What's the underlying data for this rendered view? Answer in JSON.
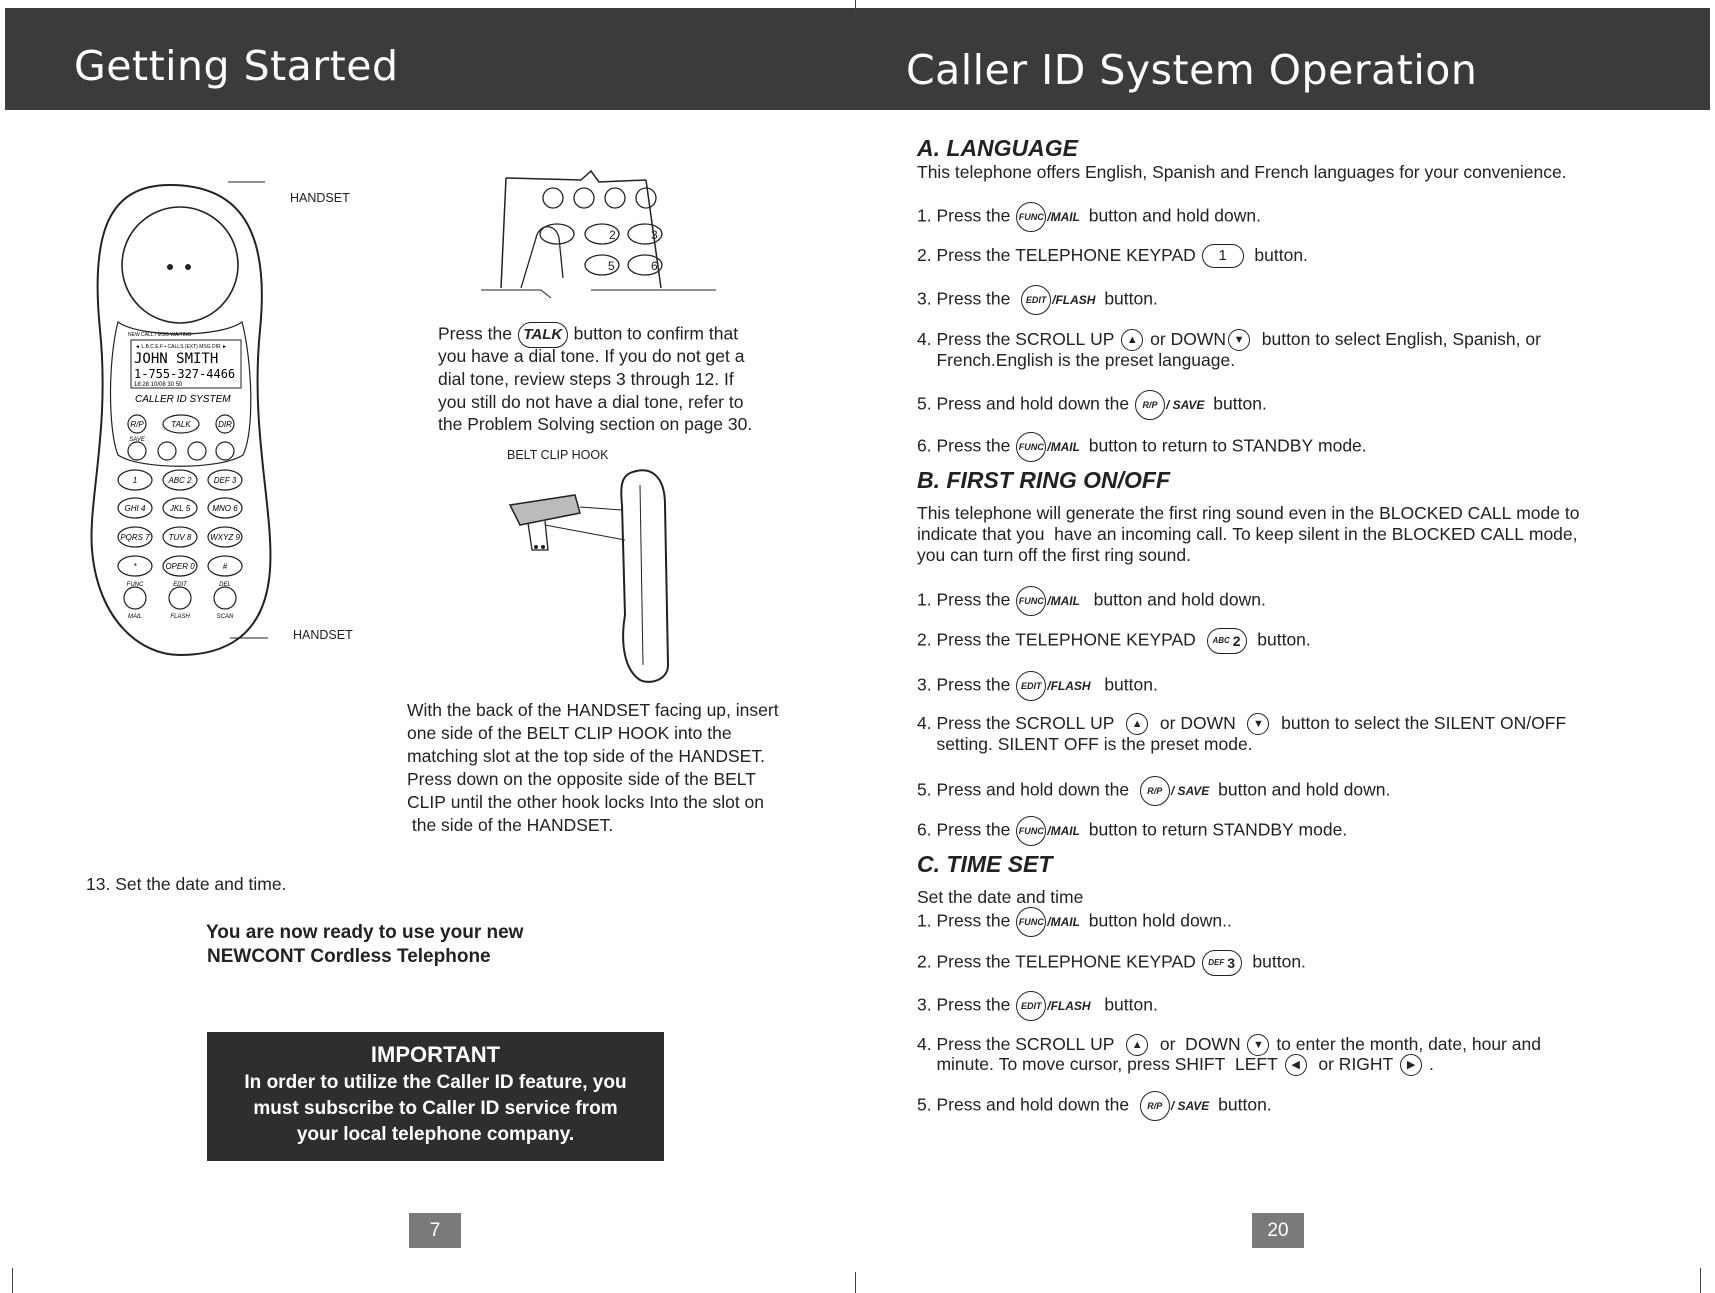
{
  "left_page": {
    "title": "Getting Started",
    "handset_label_top": "HANDSET",
    "handset_label_bottom": "HANDSET",
    "handset_display": {
      "status": "NEW CALL / MSG WAITING",
      "top_row": "◄ L.B.C.E.F ▪ CALLS (EXT) MSG DIR ►",
      "name": "JOHN  SMITH",
      "number": "1-755-327-4466",
      "bottom_row": "18:28 10/08  30  50",
      "brand": "CALLER  ID  SYSTEM",
      "keys": [
        "R/P",
        "TALK",
        "DIR",
        "SAVE",
        "1",
        "ABC 2",
        "DEF 3",
        "GHI 4",
        "JKL 5",
        "MNO 6",
        "PQRS 7",
        "TUV 8",
        "WXYZ 9",
        "*",
        "OPER 0",
        "#",
        "FUNC",
        "EDIT",
        "DEL",
        "MAIL",
        "FLASH",
        "SCAN"
      ]
    },
    "talk_text": [
      [
        "Press the ",
        {
          "key": "TALK",
          "type": "talk"
        },
        " button to confirm that"
      ],
      [
        "you have a dial tone. If you do not get a"
      ],
      [
        "dial tone, review steps 3 through 12. If"
      ],
      [
        "you still do not have a dial tone, refer to"
      ],
      [
        "the Problem Solving section on page 30."
      ]
    ],
    "belt_clip_label": "BELT CLIP HOOK",
    "belt_clip_text": [
      "With the back of the HANDSET facing up, insert",
      "one side of the BELT CLIP HOOK into the",
      "matching slot at the top side of the HANDSET.",
      "Press down on the opposite side of the BELT",
      "CLIP until the other hook locks Into the slot on",
      " the side of the HANDSET."
    ],
    "step13": "13. Set the date and time.",
    "ready_lines": [
      "You are now ready to use your new",
      "NEWCONT Cordless Telephone"
    ],
    "important": {
      "title": "IMPORTANT",
      "lines": [
        "In order to utilize the Caller ID feature, you",
        "must subscribe to Caller ID service from",
        "your local telephone company."
      ]
    },
    "page_number": "7"
  },
  "right_page": {
    "title": "Caller ID System Operation",
    "sections": [
      {
        "heading": "A. LANGUAGE",
        "lines": [
          [
            "This telephone offers English, Spanish and French languages for your convenience."
          ],
          [
            "1. Press the ",
            {
              "key": "FUNC",
              "label": "/MAIL"
            },
            " button and hold down."
          ],
          [
            "2. Press the TELEPHONE KEYPAD ",
            {
              "key": "1",
              "type": "oval"
            },
            "  button."
          ],
          [
            "3. Press the  ",
            {
              "key": "EDIT",
              "label": "/FLASH"
            },
            " button."
          ],
          [
            "4. Press the SCROLL UP ",
            {
              "arrow": "up"
            },
            " or DOWN",
            {
              "arrow": "down"
            },
            "  button to select English, Spanish, or"
          ],
          [
            "    French.English is the preset language."
          ],
          [
            "5. Press and hold down the ",
            {
              "key": "R/P",
              "label": "/ SAVE"
            },
            " button."
          ],
          [
            "6. Press the ",
            {
              "key": "FUNC",
              "label": "/MAIL"
            },
            " button to return to STANDBY mode."
          ]
        ]
      },
      {
        "heading": "B. FIRST RING ON/OFF",
        "lines": [
          [
            "This telephone will generate the first ring sound even in the BLOCKED CALL mode to"
          ],
          [
            "indicate that you  have an incoming call. To keep silent in the BLOCKED CALL mode,"
          ],
          [
            "you can turn off the first ring sound."
          ],
          [
            "1. Press the ",
            {
              "key": "FUNC",
              "label": "/MAIL"
            },
            "  button and hold down."
          ],
          [
            "2. Press the TELEPHONE KEYPAD  ",
            {
              "key": "2",
              "sub": "ABC",
              "type": "num"
            },
            "  button."
          ],
          [
            "3. Press the ",
            {
              "key": "EDIT",
              "label": "/FLASH"
            },
            "  button."
          ],
          [
            "4. Press the SCROLL UP  ",
            {
              "arrow": "up"
            },
            "  or DOWN  ",
            {
              "arrow": "down"
            },
            "  button to select the SILENT ON/OFF"
          ],
          [
            "    setting. SILENT OFF is the preset mode."
          ],
          [
            "5. Press and hold down the  ",
            {
              "key": "R/P",
              "label": "/ SAVE"
            },
            " button and hold down."
          ],
          [
            "6. Press the ",
            {
              "key": "FUNC",
              "label": "/MAIL"
            },
            " button to return STANDBY mode."
          ]
        ]
      },
      {
        "heading": "C. TIME SET",
        "lines": [
          [
            "Set the date and time"
          ],
          [
            "1. Press the ",
            {
              "key": "FUNC",
              "label": "/MAIL"
            },
            " button hold down.."
          ],
          [
            "2. Press the TELEPHONE KEYPAD ",
            {
              "key": "3",
              "sub": "DEF",
              "type": "num"
            },
            "  button."
          ],
          [
            "3. Press the ",
            {
              "key": "EDIT",
              "label": "/FLASH"
            },
            "  button."
          ],
          [
            "4. Press the SCROLL UP  ",
            {
              "arrow": "up"
            },
            "  or  DOWN ",
            {
              "arrow": "down"
            },
            " to enter the month, date, hour and"
          ],
          [
            "    minute. To move cursor, press SHIFT  LEFT ",
            {
              "arrow": "left"
            },
            "  or RIGHT ",
            {
              "arrow": "right"
            },
            " ."
          ],
          [
            "5. Press and hold down the  ",
            {
              "key": "R/P",
              "label": "/ SAVE"
            },
            " button."
          ]
        ]
      }
    ],
    "page_number": "20"
  },
  "colors": {
    "header": "#3b3b3b",
    "important_box": "#2e2e2e",
    "page_number_box": "#7a7a7a"
  }
}
